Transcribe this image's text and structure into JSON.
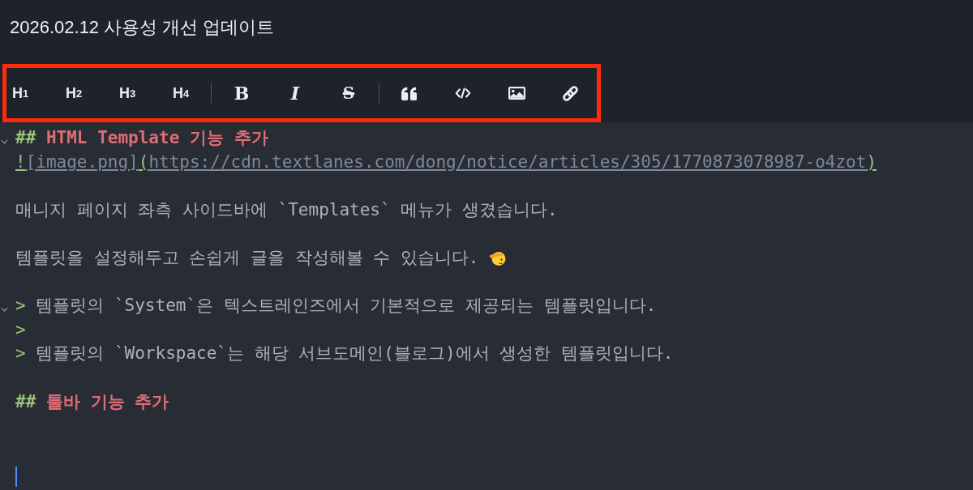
{
  "title": {
    "value": "2026.02.12 사용성 개선 업데이트"
  },
  "toolbar": {
    "highlighted": true,
    "groups": [
      [
        {
          "kind": "heading",
          "label": "H1"
        },
        {
          "kind": "heading",
          "label": "H2"
        },
        {
          "kind": "heading",
          "label": "H3"
        },
        {
          "kind": "heading",
          "label": "H4"
        }
      ],
      [
        {
          "kind": "bold",
          "label": "B"
        },
        {
          "kind": "italic",
          "label": "I"
        },
        {
          "kind": "strike",
          "label": "S"
        }
      ],
      [
        {
          "kind": "quote"
        },
        {
          "kind": "code"
        },
        {
          "kind": "image"
        },
        {
          "kind": "link"
        }
      ]
    ]
  },
  "editor": {
    "lines": [
      {
        "kind": "heading",
        "foldable": true,
        "tokens": [
          {
            "kind": "mark",
            "text": "##"
          },
          {
            "kind": "heading",
            "text": " HTML Template 기능 추가"
          }
        ]
      },
      {
        "kind": "paragraph",
        "foldable": false,
        "tokens": [
          {
            "kind": "link_mark",
            "text": "!"
          },
          {
            "kind": "link_text",
            "text": "[image.png]"
          },
          {
            "kind": "link_mark",
            "text": "("
          },
          {
            "kind": "link_text",
            "text": "https://cdn.textlanes.com/dong/notice/articles/305/1770873078987-o4zot"
          },
          {
            "kind": "link_mark",
            "text": ")"
          }
        ]
      },
      {
        "kind": "blank",
        "foldable": false
      },
      {
        "kind": "paragraph",
        "foldable": false,
        "tokens": [
          {
            "kind": "text",
            "text": "매니지 페이지 좌측 사이드바에 `Templates` 메뉴가 생겼습니다."
          }
        ]
      },
      {
        "kind": "blank",
        "foldable": false
      },
      {
        "kind": "paragraph",
        "foldable": false,
        "tokens": [
          {
            "kind": "text",
            "text": "템플릿을 설정해두고 손쉽게 글을 작성해볼 수 있습니다."
          },
          {
            "kind": "emoji"
          }
        ]
      },
      {
        "kind": "blank",
        "foldable": false
      },
      {
        "kind": "paragraph",
        "foldable": true,
        "tokens": [
          {
            "kind": "mark",
            "text": ">"
          },
          {
            "kind": "text",
            "text": " 템플릿의 `System`은 텍스트레인즈에서 기본적으로 제공되는 템플릿입니다."
          }
        ]
      },
      {
        "kind": "paragraph",
        "foldable": false,
        "tokens": [
          {
            "kind": "mark",
            "text": ">"
          }
        ]
      },
      {
        "kind": "paragraph",
        "foldable": false,
        "tokens": [
          {
            "kind": "mark",
            "text": ">"
          },
          {
            "kind": "text",
            "text": " 템플릿의 `Workspace`는 해당 서브도메인(블로그)에서 생성한 템플릿입니다."
          }
        ]
      },
      {
        "kind": "blank",
        "foldable": false
      },
      {
        "kind": "heading",
        "foldable": false,
        "tokens": [
          {
            "kind": "mark",
            "text": "##"
          },
          {
            "kind": "heading",
            "text": " 툴바 기능 추가"
          }
        ]
      },
      {
        "kind": "blank",
        "foldable": false
      },
      {
        "kind": "blank",
        "foldable": false
      },
      {
        "kind": "paragraph",
        "foldable": false,
        "tokens": [
          {
            "kind": "cursor"
          }
        ]
      }
    ]
  }
}
